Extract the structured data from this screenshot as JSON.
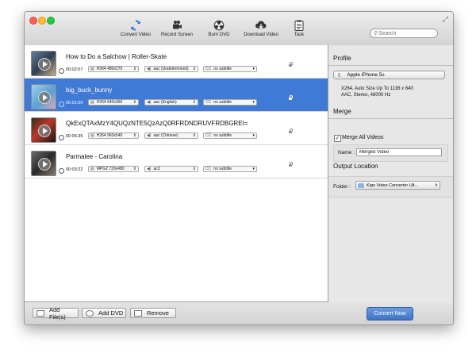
{
  "toolbar": {
    "items": [
      {
        "label": "Convert Video",
        "icon": "refresh-icon"
      },
      {
        "label": "Record Screen",
        "icon": "video-camera-icon"
      },
      {
        "label": "Burn DVD",
        "icon": "radiation-icon"
      },
      {
        "label": "Download Video",
        "icon": "cloud-download-icon"
      },
      {
        "label": "Task",
        "icon": "clipboard-icon"
      }
    ],
    "search_placeholder": "Search"
  },
  "videos": [
    {
      "title": "How to Do a Salchow | Roller-Skate",
      "duration": "00:02:07",
      "video": "H264 480x270",
      "audio": "aac (Undetermined)",
      "subtitle": "no subtitle",
      "selected": false
    },
    {
      "title": "big_buck_bunny",
      "duration": "00:01:00",
      "video": "H264 640x360",
      "audio": "aac (English)",
      "subtitle": "no subtitle",
      "selected": true
    },
    {
      "title": "QkExQTAxMzY4QUQzNTE5QzAzQ0RFRDNDRUVFRDBGREI=",
      "duration": "00:05:35",
      "video": "H264 960x540",
      "audio": "aac (Chinese)",
      "subtitle": "no subtitle",
      "selected": false
    },
    {
      "title": "Parmalee - Carolina",
      "duration": "00:03:22",
      "video": "MPG2 720x480",
      "audio": "ac3",
      "subtitle": "no subtitle",
      "selected": false
    }
  ],
  "cc_label": "CC",
  "panel": {
    "profile_title": "Profile",
    "profile_value": "Apple iPhone 5s",
    "profile_desc_1": "X264, Auto Size Up To 1136 x 640",
    "profile_desc_2": "AAC, Stereo, 48000 Hz",
    "merge_title": "Merge",
    "merge_checkbox_label": "Merge All Videos",
    "name_label": "Name :",
    "name_value": "Merged Video",
    "output_title": "Output Location",
    "folder_label": "Folder :",
    "folder_value": "Kigo Video Converter Ult..."
  },
  "bottom": {
    "add_files": "Add File(s)",
    "add_dvd": "Add DVD",
    "remove": "Remove",
    "convert_now": "Convert Now"
  },
  "colors": {
    "selection": "#3f7ad6",
    "convert_button": "#4a7fcf"
  }
}
